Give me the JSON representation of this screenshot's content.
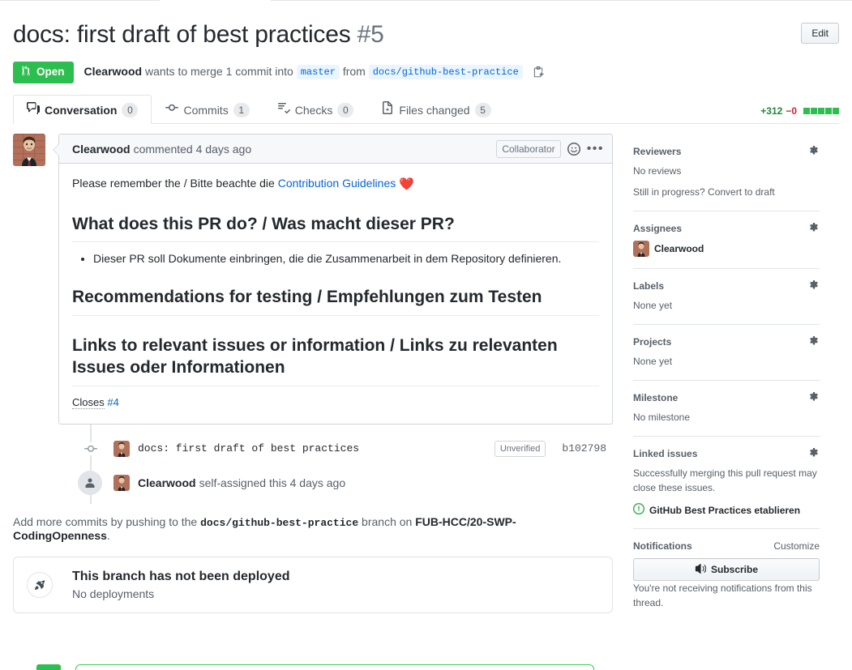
{
  "header": {
    "title": "docs: first draft of best practices",
    "number": "#5",
    "edit_label": "Edit",
    "state": "Open",
    "author": "Clearwood",
    "merge_text_1": "wants to merge 1 commit into",
    "base_branch": "master",
    "merge_text_2": "from",
    "head_branch": "docs/github-best-practice",
    "copy_icon": "clipboard-copy-icon"
  },
  "tabs": [
    {
      "label": "Conversation",
      "count": "0",
      "icon": "comment-discussion-icon",
      "active": true
    },
    {
      "label": "Commits",
      "count": "1",
      "icon": "git-commit-icon",
      "active": false
    },
    {
      "label": "Checks",
      "count": "0",
      "icon": "checklist-icon",
      "active": false
    },
    {
      "label": "Files changed",
      "count": "5",
      "icon": "file-diff-icon",
      "active": false
    }
  ],
  "diffstat": {
    "additions": "+312",
    "deletions": "−0",
    "blocks": 5,
    "add_color": "#22863a",
    "del_color": "#cb2431",
    "block_color": "#2cbe4e"
  },
  "comment": {
    "author": "Clearwood",
    "action": "commented 4 days ago",
    "role_badge": "Collaborator",
    "reaction_icon": "smiley-icon",
    "menu_icon": "kebab-horizontal-icon",
    "intro_prefix": "Please remember the / Bitte beachte die ",
    "intro_link": "Contribution Guidelines",
    "intro_emoji": "❤️",
    "heading_1": "What does this PR do? / Was macht dieser PR?",
    "bullet_1": "Dieser PR soll Dokumente einbringen, die die Zusammenarbeit in dem Repository definieren.",
    "heading_2": "Recommendations for testing / Empfehlungen zum Testen",
    "heading_3": "Links to relevant issues or information / Links zu relevanten Issues oder Informationen",
    "closes_word": "Closes",
    "closes_issue": "#4"
  },
  "timeline": {
    "commit": {
      "icon": "git-commit-icon",
      "message": "docs: first draft of best practices",
      "verification": "Unverified",
      "sha": "b102798"
    },
    "assigned": {
      "icon": "person-icon",
      "author": "Clearwood",
      "action": "self-assigned this 4 days ago"
    }
  },
  "push_note": {
    "prefix": "Add more commits by pushing to the ",
    "branch": "docs/github-best-practice",
    "middle": " branch on ",
    "repo": "FUB-HCC/20-SWP-CodingOpenness",
    "suffix": "."
  },
  "deployment": {
    "icon": "rocket-icon",
    "title": "This branch has not been deployed",
    "subtitle": "No deployments"
  },
  "sidebar": {
    "reviewers": {
      "title": "Reviewers",
      "gear_icon": "gear-icon",
      "note_1": "No reviews",
      "note_2": "Still in progress? Convert to draft"
    },
    "assignees": {
      "title": "Assignees",
      "gear_icon": "gear-icon",
      "name": "Clearwood"
    },
    "labels": {
      "title": "Labels",
      "gear_icon": "gear-icon",
      "note": "None yet"
    },
    "projects": {
      "title": "Projects",
      "gear_icon": "gear-icon",
      "note": "None yet"
    },
    "milestone": {
      "title": "Milestone",
      "gear_icon": "gear-icon",
      "note": "No milestone"
    },
    "linked_issues": {
      "title": "Linked issues",
      "gear_icon": "gear-icon",
      "note": "Successfully merging this pull request may close these issues.",
      "issue_icon": "issue-opened-icon",
      "issue_name": "GitHub Best Practices etablieren",
      "issue_color": "#28a745"
    },
    "notifications": {
      "title": "Notifications",
      "customize": "Customize",
      "button_label": "Subscribe",
      "button_icon": "unmute-icon",
      "note": "You're not receiving notifications from this thread."
    }
  }
}
